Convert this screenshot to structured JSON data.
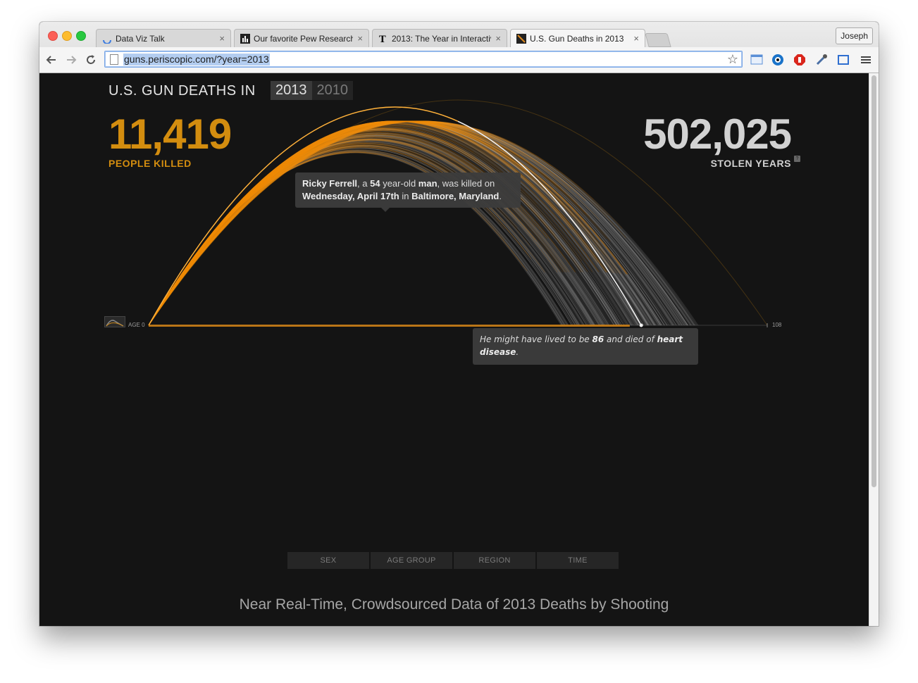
{
  "browser": {
    "tabs": [
      {
        "label": "Data Viz Talk",
        "favicon": "loading-spinner-icon",
        "active": false
      },
      {
        "label": "Our favorite Pew Research",
        "favicon": "bar-chart-icon",
        "active": false
      },
      {
        "label": "2013: The Year in Interactiv",
        "favicon": "nyt-logo-icon",
        "active": false
      },
      {
        "label": "U.S. Gun Deaths in 2013",
        "favicon": "periscopic-icon",
        "active": true
      }
    ],
    "close_glyph": "×",
    "profile_name": "Joseph",
    "url": "guns.periscopic.com/?year=2013"
  },
  "header": {
    "title": "U.S. GUN DEATHS IN",
    "years": [
      "2013",
      "2010"
    ],
    "selected_year": "2013"
  },
  "stats": {
    "killed_number": "11,419",
    "killed_label": "PEOPLE KILLED",
    "stolen_number": "502,025",
    "stolen_label": "STOLEN YEARS",
    "info_glyph": "?"
  },
  "tooltip_victim": {
    "name": "Ricky Ferrell",
    "t1": ", a ",
    "age": "54",
    "t2": " year-old ",
    "sex": "man",
    "t3": ", was killed on",
    "date": "Wednesday, April 17th",
    "t4": " in ",
    "place": "Baltimore, Maryland",
    "t5": "."
  },
  "tooltip_life": {
    "t1": "He might have lived to be ",
    "age": "86",
    "t2": " and died of ",
    "cause": "heart disease",
    "t3": "."
  },
  "axis": {
    "start_label": "AGE 0",
    "end_label": "108",
    "end_value": 108
  },
  "highlight": {
    "age_at_death": 54,
    "expected_age": 86
  },
  "filters": [
    "SEX",
    "AGE GROUP",
    "REGION",
    "TIME"
  ],
  "footer": {
    "title": "Near Real-Time, Crowdsourced Data of 2013 Deaths by Shooting"
  },
  "colors": {
    "killed_orange": "#d38d0f",
    "lived_gray": "#bdbdbd",
    "background": "#141414"
  }
}
